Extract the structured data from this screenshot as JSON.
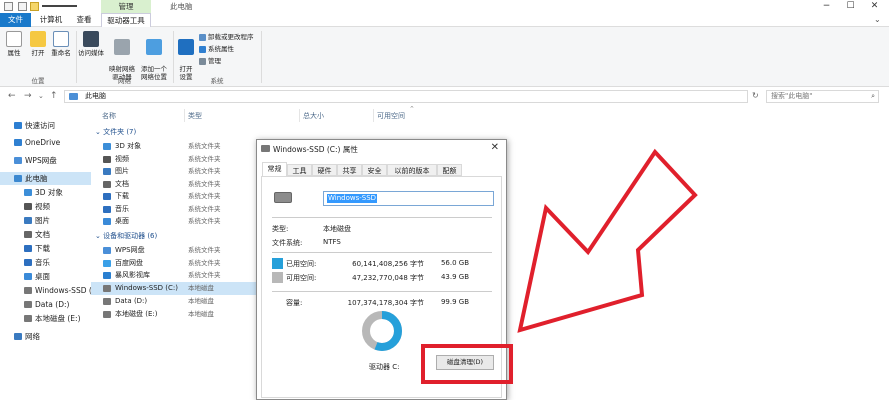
{
  "title_bar": {
    "manage_tab": "管理",
    "window_title": "此电脑",
    "controls": {
      "minimize": "−",
      "maximize": "☐",
      "close": "✕"
    }
  },
  "ribbon_tabs": [
    "文件",
    "计算机",
    "查看",
    "驱动器工具"
  ],
  "ribbon": {
    "buttons": [
      {
        "label": "属性",
        "icon": "properties-icon"
      },
      {
        "label": "打开",
        "icon": "open-folder-icon"
      },
      {
        "label": "重命名",
        "icon": "rename-icon"
      },
      {
        "label": "访问媒体",
        "icon": "media-server-icon"
      },
      {
        "label": "映射网络\n驱动器",
        "icon": "map-drive-icon"
      },
      {
        "label": "添加一个\n网络位置",
        "icon": "network-location-icon"
      },
      {
        "label": "打开\n设置",
        "icon": "settings-gear-icon"
      }
    ],
    "system_items": [
      "卸载或更改程序",
      "系统属性",
      "管理"
    ],
    "groups": [
      "位置",
      "网络",
      "系统"
    ]
  },
  "address": {
    "path": "此电脑",
    "search_placeholder": "搜索\"此电脑\""
  },
  "nav_pane": {
    "items": [
      {
        "label": "快速访问",
        "icon": "star-icon",
        "color": "#2d7fd2"
      },
      {
        "label": "OneDrive",
        "icon": "cloud-icon",
        "color": "#2f80d1"
      },
      {
        "label": "WPS网盘",
        "icon": "cloud-drive-icon",
        "color": "#4a8fd8"
      },
      {
        "label": "此电脑",
        "icon": "computer-icon",
        "color": "#3b88d0"
      },
      {
        "label": "3D 对象",
        "icon": "3d-objects-icon",
        "color": "#3c8ed8"
      },
      {
        "label": "视频",
        "icon": "video-icon",
        "color": "#555555"
      },
      {
        "label": "图片",
        "icon": "pictures-icon",
        "color": "#3a7ac0"
      },
      {
        "label": "文档",
        "icon": "documents-icon",
        "color": "#666666"
      },
      {
        "label": "下载",
        "icon": "download-icon",
        "color": "#2d6fbf"
      },
      {
        "label": "音乐",
        "icon": "music-icon",
        "color": "#2d6fbf"
      },
      {
        "label": "桌面",
        "icon": "desktop-icon",
        "color": "#3a8ad8"
      },
      {
        "label": "Windows-SSD (C:)",
        "icon": "drive-icon",
        "color": "#777777"
      },
      {
        "label": "Data (D:)",
        "icon": "drive-icon",
        "color": "#777777"
      },
      {
        "label": "本地磁盘 (E:)",
        "icon": "drive-icon",
        "color": "#777777"
      },
      {
        "label": "网络",
        "icon": "network-icon",
        "color": "#3a7ac0"
      }
    ]
  },
  "columns": [
    "名称",
    "类型",
    "总大小",
    "可用空间"
  ],
  "folders": {
    "header": "文件夹 (7)",
    "items": [
      {
        "name": "3D 对象",
        "type": "系统文件夹",
        "icon": "3d-objects-icon",
        "color": "#3c8ed8"
      },
      {
        "name": "视频",
        "type": "系统文件夹",
        "icon": "video-icon",
        "color": "#555555"
      },
      {
        "name": "图片",
        "type": "系统文件夹",
        "icon": "pictures-icon",
        "color": "#3a7ac0"
      },
      {
        "name": "文档",
        "type": "系统文件夹",
        "icon": "documents-icon",
        "color": "#666666"
      },
      {
        "name": "下载",
        "type": "系统文件夹",
        "icon": "download-icon",
        "color": "#2d6fbf"
      },
      {
        "name": "音乐",
        "type": "系统文件夹",
        "icon": "music-icon",
        "color": "#2d6fbf"
      },
      {
        "name": "桌面",
        "type": "系统文件夹",
        "icon": "desktop-icon",
        "color": "#3a8ad8"
      }
    ]
  },
  "devices": {
    "header": "设备和驱动器 (6)",
    "items": [
      {
        "name": "WPS网盘",
        "type": "系统文件夹",
        "icon": "cloud-drive-icon",
        "color": "#4a8fd8"
      },
      {
        "name": "百度网盘",
        "type": "系统文件夹",
        "icon": "baidu-netdisk-icon",
        "color": "#3aa0e8"
      },
      {
        "name": "暴风影视库",
        "type": "系统文件夹",
        "icon": "video-library-icon",
        "color": "#2a7fd0"
      },
      {
        "name": "Windows-SSD (C:)",
        "type": "本地磁盘",
        "icon": "drive-icon",
        "color": "#777777"
      },
      {
        "name": "Data (D:)",
        "type": "本地磁盘",
        "icon": "drive-icon",
        "color": "#777777"
      },
      {
        "name": "本地磁盘 (E:)",
        "type": "本地磁盘",
        "icon": "drive-icon",
        "color": "#777777"
      }
    ]
  },
  "dialog": {
    "title": "Windows-SSD (C:) 属性",
    "close": "✕",
    "tabs": [
      "常规",
      "工具",
      "硬件",
      "共享",
      "安全",
      "以前的版本",
      "配额"
    ],
    "name_value": "Windows-SSD",
    "type_label": "类型:",
    "type_value": "本地磁盘",
    "fs_label": "文件系统:",
    "fs_value": "NTFS",
    "used_label": "已用空间:",
    "used_bytes": "60,141,408,256 字节",
    "used_gb": "56.0 GB",
    "free_label": "可用空间:",
    "free_bytes": "47,232,770,048 字节",
    "free_gb": "43.9 GB",
    "capacity_label": "容量:",
    "capacity_bytes": "107,374,178,304 字节",
    "capacity_gb": "99.9 GB",
    "drive_label": "驱动器 C:",
    "cleanup_button": "磁盘清理(D)",
    "used_fraction": 0.56,
    "used_color": "#26a0da",
    "free_color": "#b8b8b8"
  },
  "accent": "#1979ca",
  "annotation_color": "#e0202c"
}
